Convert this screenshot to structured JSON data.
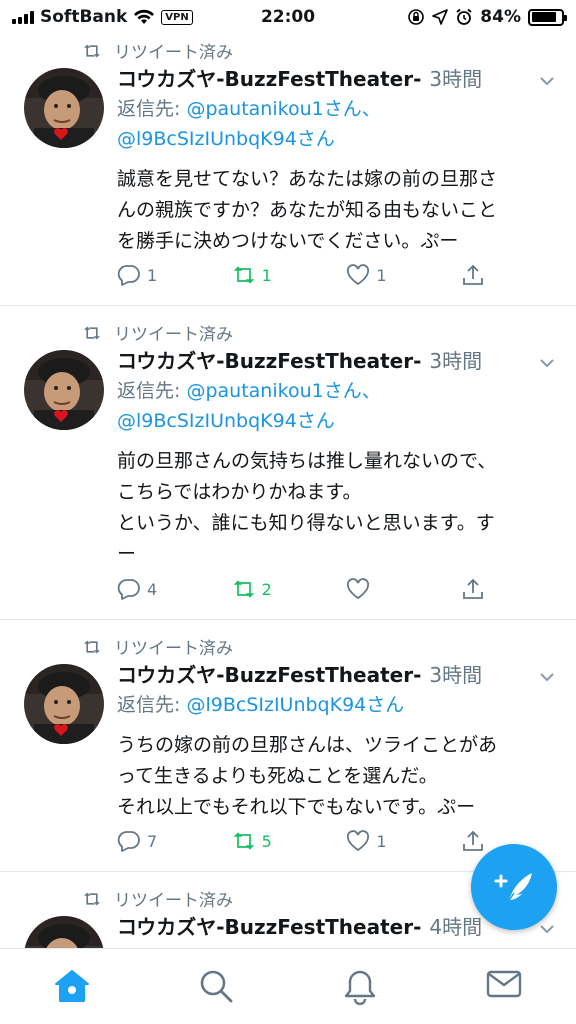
{
  "status_bar": {
    "carrier": "SoftBank",
    "vpn": "VPN",
    "time": "22:00",
    "battery": "84%",
    "battery_level": 0.84
  },
  "tweets": [
    {
      "retweet_label": "リツイート済み",
      "name": "コウカズヤ-BuzzFestTheater-",
      "time": "3時間",
      "reply_prefix": "返信先: ",
      "reply_line1": "@pautanikou1さん、",
      "reply_line2": "@l9BcSIzIUnbqK94さん",
      "text": "誠意を見せてない？あなたは嫁の前の旦那さ\nんの親族ですか？あなたが知る由もないこと\nを勝手に決めつけないでください。ぷー",
      "reply_count": "1",
      "retweet_count": "1",
      "like_count": "1"
    },
    {
      "retweet_label": "リツイート済み",
      "name": "コウカズヤ-BuzzFestTheater-",
      "time": "3時間",
      "reply_prefix": "返信先: ",
      "reply_line1": "@pautanikou1さん、",
      "reply_line2": "@l9BcSIzIUnbqK94さん",
      "text": "前の旦那さんの気持ちは推し量れないので、\nこちらではわかりかねます。\nというか、誰にも知り得ないと思います。す\nー",
      "reply_count": "4",
      "retweet_count": "2",
      "like_count": ""
    },
    {
      "retweet_label": "リツイート済み",
      "name": "コウカズヤ-BuzzFestTheater-",
      "time": "3時間",
      "reply_prefix": "返信先: ",
      "reply_line1": "@l9BcSIzIUnbqK94さん",
      "text": "うちの嫁の前の旦那さんは、ツライことがあ\nって生きるよりも死ぬことを選んだ。\nそれ以上でもそれ以下でもないです。ぷー",
      "reply_count": "7",
      "retweet_count": "5",
      "like_count": "1"
    },
    {
      "retweet_label": "リツイート済み",
      "name": "コウカズヤ-BuzzFestTheater-",
      "time": "4時間"
    }
  ],
  "colors": {
    "accent": "#1da1f2",
    "link": "#1b95e0",
    "retweet_active": "#17bf63",
    "muted": "#657786"
  }
}
